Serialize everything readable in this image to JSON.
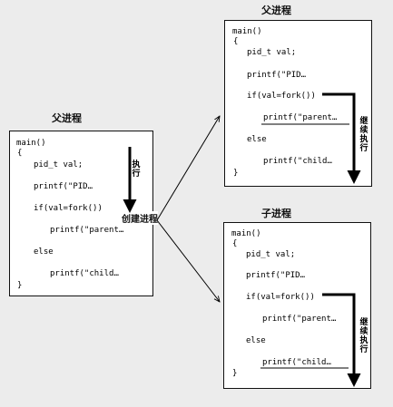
{
  "parent_panel": {
    "title": "父进程",
    "code": [
      "main()",
      "{",
      "pid_t val;",
      "printf(\"PID…",
      "if(val=fork())",
      "printf(\"parent…",
      "else",
      "printf(\"child…",
      "}"
    ],
    "exec_label": "执行"
  },
  "fork_label": "创建进程",
  "parent_after_panel": {
    "title": "父进程",
    "code": [
      "main()",
      "{",
      "pid_t val;",
      "printf(\"PID…",
      "if(val=fork())",
      "printf(\"parent…",
      "else",
      "printf(\"child…",
      "}"
    ],
    "continue_label": "继续执行"
  },
  "child_panel": {
    "title": "子进程",
    "code": [
      "main()",
      "{",
      "pid_t val;",
      "printf(\"PID…",
      "if(val=fork())",
      "printf(\"parent…",
      "else",
      "printf(\"child…",
      "}"
    ],
    "continue_label": "继续执行"
  }
}
